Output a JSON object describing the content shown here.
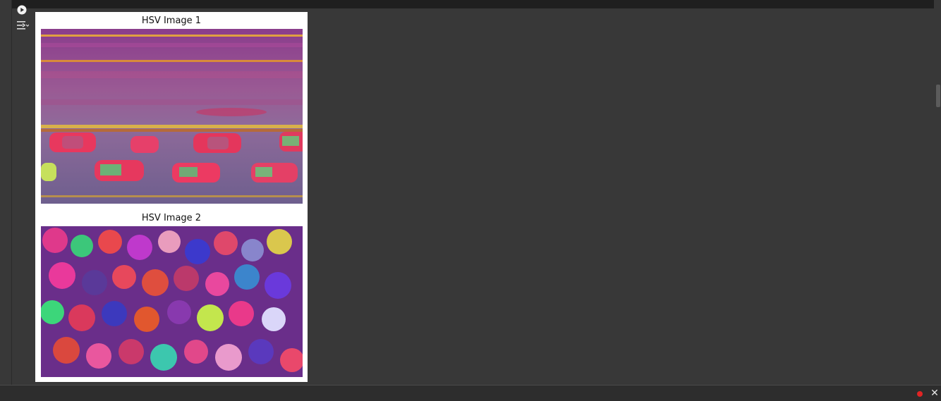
{
  "toolbar": {
    "run_icon": "play-circle-icon",
    "output_icon": "output-toggle-icon"
  },
  "output": {
    "figures": [
      {
        "title": "HSV Image 1",
        "description_icon": "hsv-traffic-image"
      },
      {
        "title": "HSV Image 2",
        "description_icon": "hsv-crowd-image"
      }
    ]
  },
  "status": {
    "close_label": "✕",
    "dot_color": "#e02424"
  },
  "colors": {
    "background": "#383838",
    "panel": "#ffffff",
    "topbar": "#1f1f1f"
  }
}
